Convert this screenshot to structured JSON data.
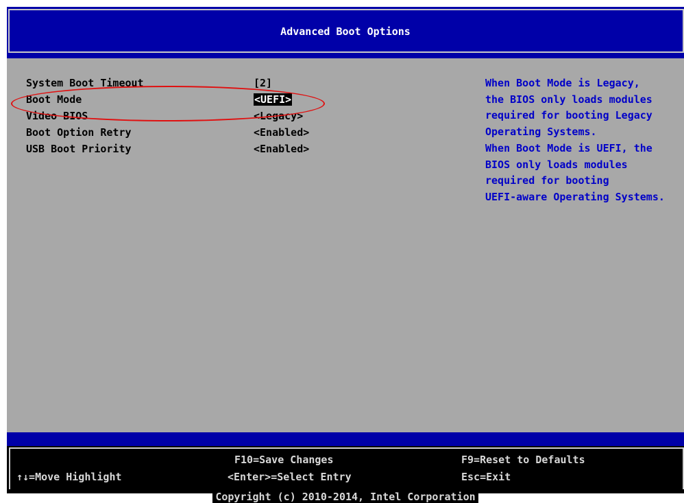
{
  "title": "Advanced Boot Options",
  "options": [
    {
      "label": "System Boot Timeout",
      "value": "[2]",
      "selected": false
    },
    {
      "label": "Boot Mode",
      "value": "<UEFI>",
      "selected": true
    },
    {
      "label": "Video BIOS",
      "value": "<Legacy>",
      "selected": false
    },
    {
      "label": "Boot Option Retry",
      "value": "<Enabled>",
      "selected": false
    },
    {
      "label": "USB Boot Priority",
      "value": "<Enabled>",
      "selected": false
    }
  ],
  "help_lines": [
    "When Boot Mode is Legacy,",
    "the BIOS only loads modules",
    "required for booting Legacy",
    "Operating Systems.",
    "When Boot Mode is UEFI, the",
    "BIOS only loads modules",
    "required for booting",
    "UEFI-aware Operating Systems."
  ],
  "footer": {
    "move_highlight": "↑↓=Move Highlight",
    "save_changes": "F10=Save Changes",
    "select_entry": "<Enter>=Select Entry",
    "reset_defaults": "F9=Reset to Defaults",
    "exit": "Esc=Exit",
    "copyright": "Copyright (c) 2010-2014, Intel Corporation"
  },
  "colors": {
    "background": "#a8a8a8",
    "title_bar": "#0000a8",
    "help_text": "#0000c8",
    "annotation": "#e01010"
  }
}
